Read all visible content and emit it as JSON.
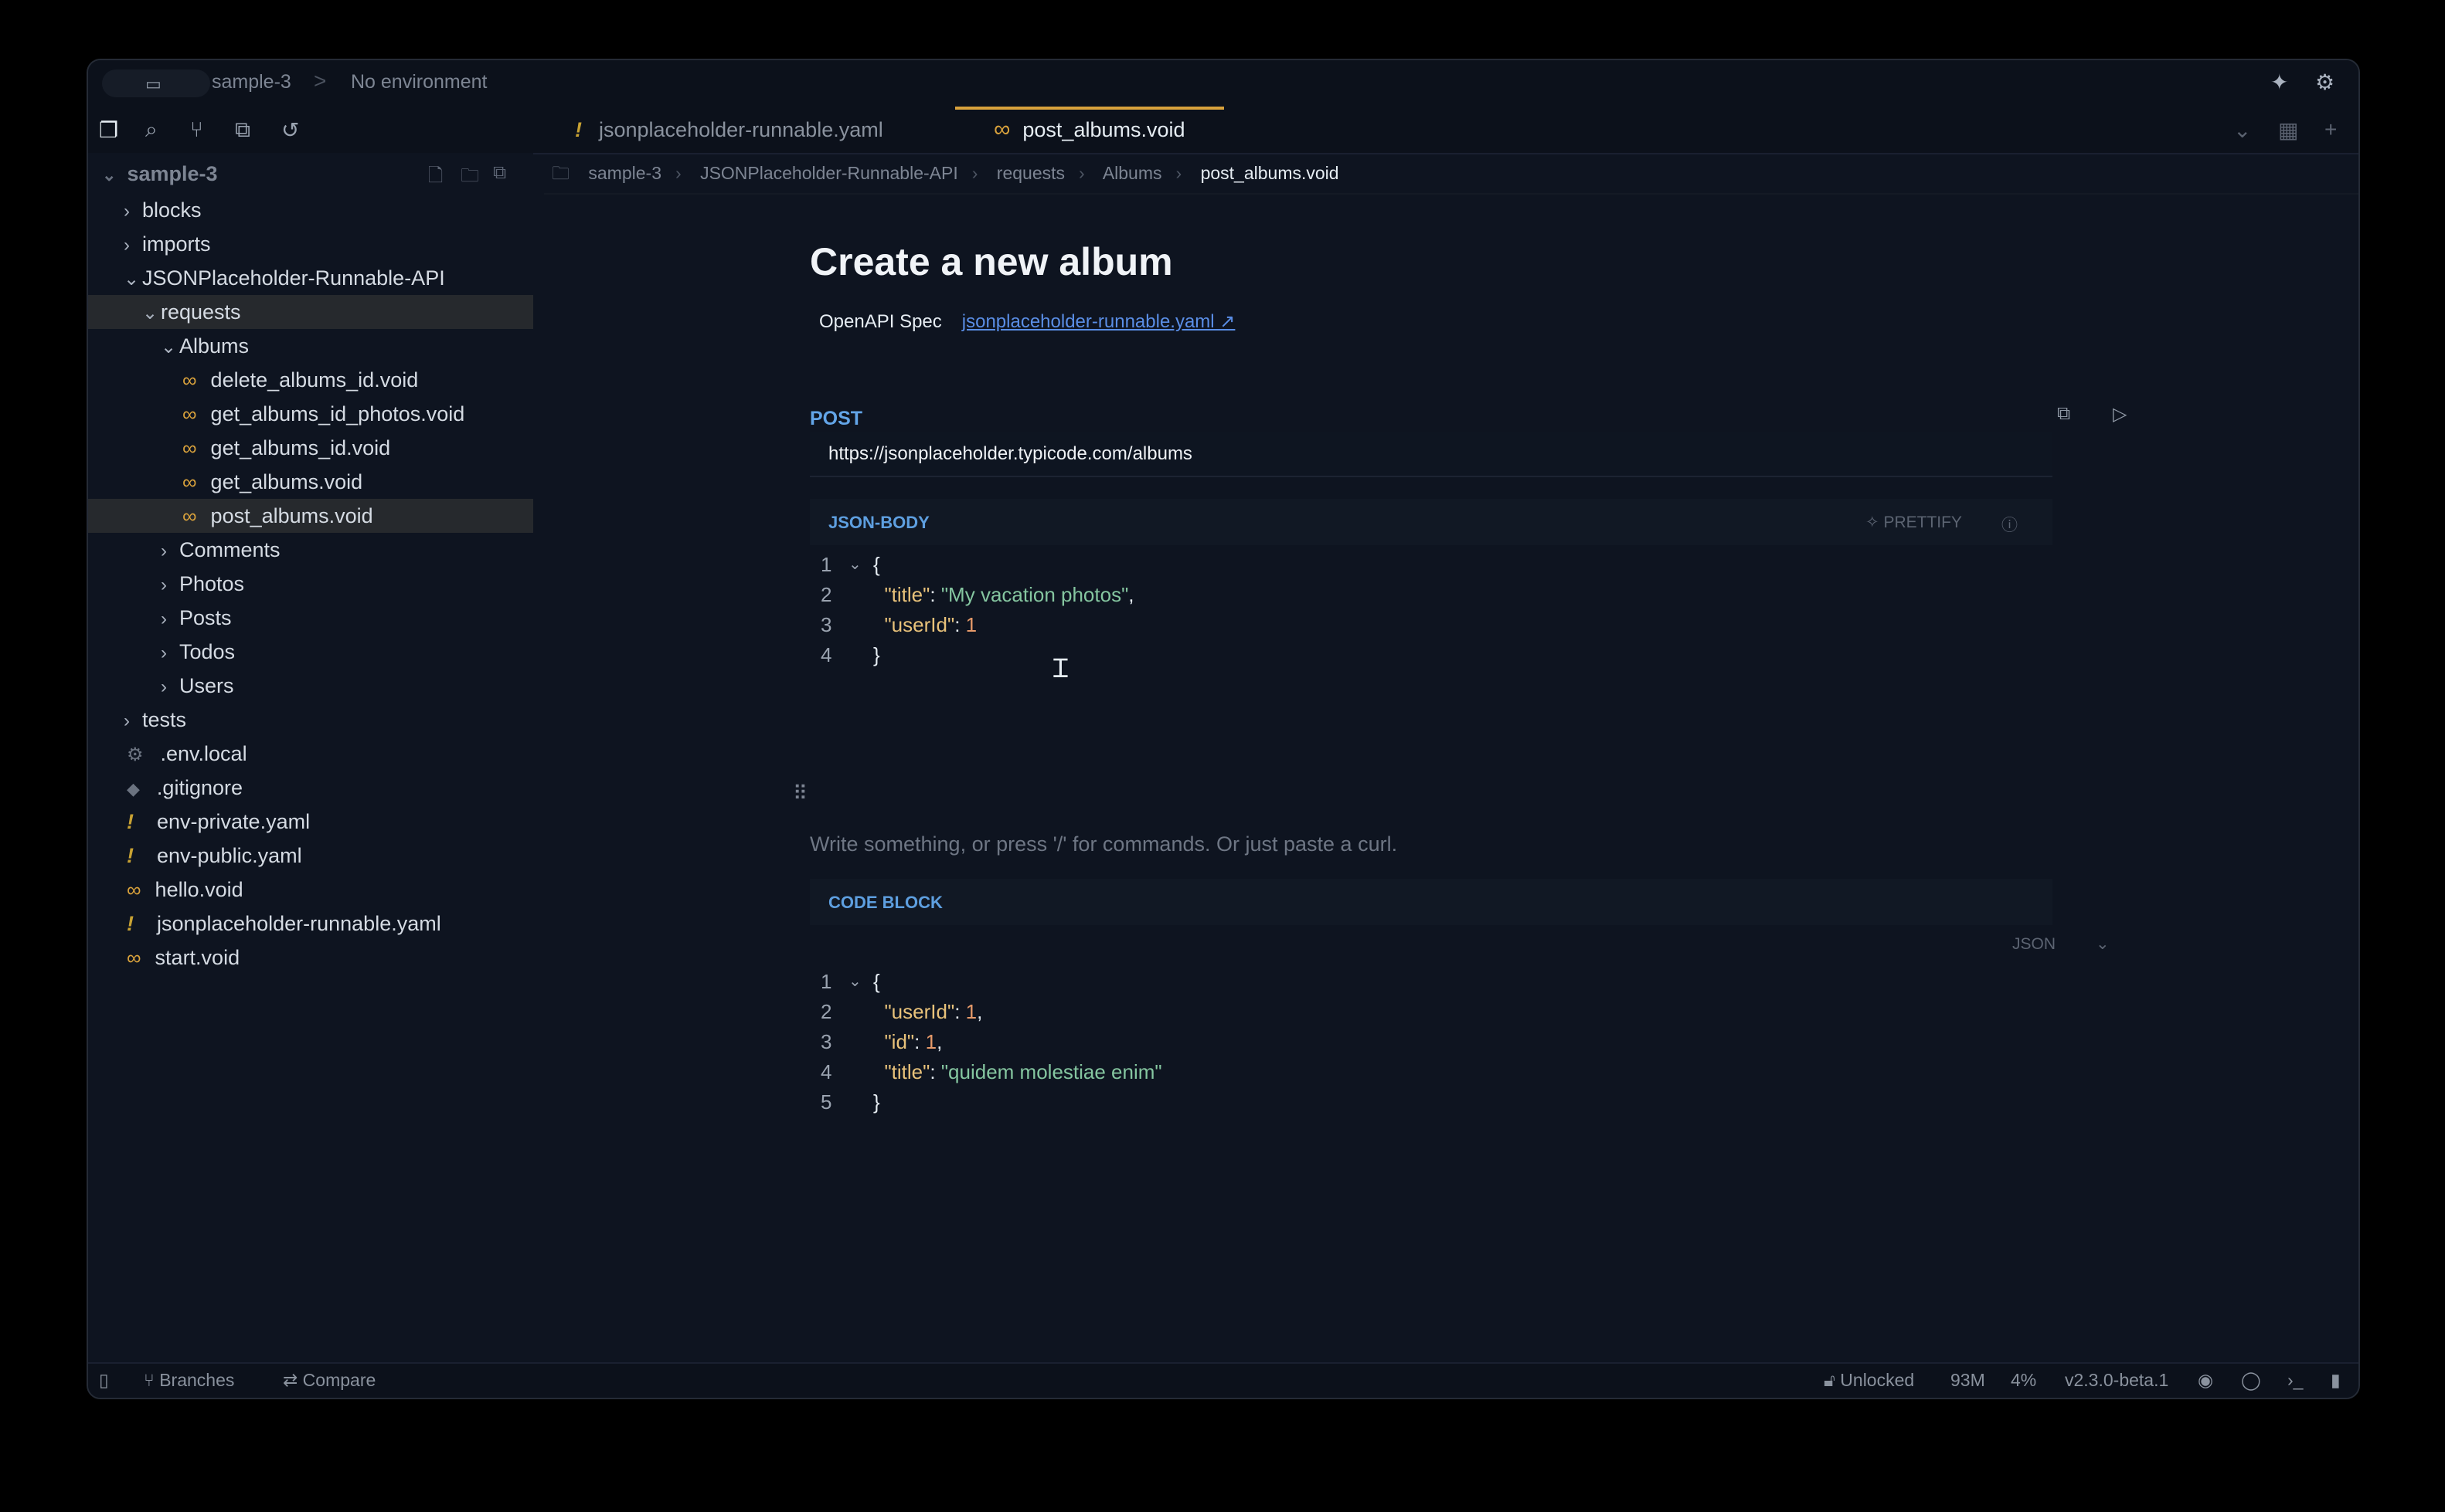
{
  "titlebar": {
    "workspace": "sample-3",
    "separator": ">",
    "environment": "No environment",
    "icons": [
      "monitor-icon",
      "sparkle-icon",
      "gear-icon"
    ]
  },
  "activity": {
    "icons": [
      "files-icon",
      "search-icon",
      "git-branch-icon",
      "extensions-icon",
      "history-icon"
    ]
  },
  "tabs": [
    {
      "label": "jsonplaceholder-runnable.yaml",
      "type": "yaml",
      "active": false
    },
    {
      "label": "post_albums.void",
      "type": "void",
      "active": true
    }
  ],
  "sidebar": {
    "workspace": "sample-3",
    "tree": [
      {
        "label": "blocks",
        "kind": "folder",
        "depth": 0,
        "open": false
      },
      {
        "label": "imports",
        "kind": "folder",
        "depth": 0,
        "open": false
      },
      {
        "label": "JSONPlaceholder-Runnable-API",
        "kind": "folder",
        "depth": 0,
        "open": true
      },
      {
        "label": "requests",
        "kind": "folder",
        "depth": 1,
        "open": true,
        "selected": true
      },
      {
        "label": "Albums",
        "kind": "folder",
        "depth": 2,
        "open": true
      },
      {
        "label": "delete_albums_id.void",
        "kind": "void",
        "depth": 3
      },
      {
        "label": "get_albums_id_photos.void",
        "kind": "void",
        "depth": 3
      },
      {
        "label": "get_albums_id.void",
        "kind": "void",
        "depth": 3
      },
      {
        "label": "get_albums.void",
        "kind": "void",
        "depth": 3
      },
      {
        "label": "post_albums.void",
        "kind": "void",
        "depth": 3,
        "selected": true
      },
      {
        "label": "Comments",
        "kind": "folder",
        "depth": 2,
        "open": false
      },
      {
        "label": "Photos",
        "kind": "folder",
        "depth": 2,
        "open": false
      },
      {
        "label": "Posts",
        "kind": "folder",
        "depth": 2,
        "open": false
      },
      {
        "label": "Todos",
        "kind": "folder",
        "depth": 2,
        "open": false
      },
      {
        "label": "Users",
        "kind": "folder",
        "depth": 2,
        "open": false
      },
      {
        "label": "tests",
        "kind": "folder",
        "depth": 0,
        "open": false
      },
      {
        "label": ".env.local",
        "kind": "env",
        "depth": 0
      },
      {
        "label": ".gitignore",
        "kind": "git",
        "depth": 0
      },
      {
        "label": "env-private.yaml",
        "kind": "yaml",
        "depth": 0
      },
      {
        "label": "env-public.yaml",
        "kind": "yaml",
        "depth": 0
      },
      {
        "label": "hello.void",
        "kind": "void",
        "depth": 0
      },
      {
        "label": "jsonplaceholder-runnable.yaml",
        "kind": "yaml",
        "depth": 0
      },
      {
        "label": "start.void",
        "kind": "void",
        "depth": 0
      }
    ]
  },
  "breadcrumb": [
    "sample-3",
    "JSONPlaceholder-Runnable-API",
    "requests",
    "Albums",
    "post_albums.void"
  ],
  "doc": {
    "title": "Create a new album",
    "spec_label": "OpenAPI Spec",
    "spec_link": "jsonplaceholder-runnable.yaml ↗",
    "method": "POST",
    "url": "https://jsonplaceholder.typicode.com/albums",
    "body_header": "JSON-BODY",
    "prettify": "PRETTIFY",
    "placeholder": "Write something, or press '/' for commands. Or just paste a curl.",
    "code_header": "CODE BLOCK",
    "code_lang": "JSON"
  },
  "body_lines": [
    {
      "n": "1",
      "fold": true,
      "parts": [
        {
          "c": "",
          "t": "{"
        }
      ]
    },
    {
      "n": "2",
      "fold": false,
      "parts": [
        {
          "c": "",
          "t": "  "
        },
        {
          "c": "key",
          "t": "\"title\""
        },
        {
          "c": "",
          "t": ": "
        },
        {
          "c": "str",
          "t": "\"My vacation photos\""
        },
        {
          "c": "",
          "t": ","
        }
      ]
    },
    {
      "n": "3",
      "fold": false,
      "parts": [
        {
          "c": "",
          "t": "  "
        },
        {
          "c": "key",
          "t": "\"userId\""
        },
        {
          "c": "",
          "t": ": "
        },
        {
          "c": "num",
          "t": "1"
        }
      ]
    },
    {
      "n": "4",
      "fold": false,
      "parts": [
        {
          "c": "",
          "t": "}"
        }
      ]
    }
  ],
  "code_lines": [
    {
      "n": "1",
      "fold": true,
      "parts": [
        {
          "c": "",
          "t": "{"
        }
      ]
    },
    {
      "n": "2",
      "fold": false,
      "parts": [
        {
          "c": "",
          "t": "  "
        },
        {
          "c": "key",
          "t": "\"userId\""
        },
        {
          "c": "",
          "t": ": "
        },
        {
          "c": "num",
          "t": "1"
        },
        {
          "c": "",
          "t": ","
        }
      ]
    },
    {
      "n": "3",
      "fold": false,
      "parts": [
        {
          "c": "",
          "t": "  "
        },
        {
          "c": "key",
          "t": "\"id\""
        },
        {
          "c": "",
          "t": ": "
        },
        {
          "c": "num",
          "t": "1"
        },
        {
          "c": "",
          "t": ","
        }
      ]
    },
    {
      "n": "4",
      "fold": false,
      "parts": [
        {
          "c": "",
          "t": "  "
        },
        {
          "c": "key",
          "t": "\"title\""
        },
        {
          "c": "",
          "t": ": "
        },
        {
          "c": "str",
          "t": "\"quidem molestiae enim\""
        }
      ]
    },
    {
      "n": "5",
      "fold": false,
      "parts": [
        {
          "c": "",
          "t": "}"
        }
      ]
    }
  ],
  "statusbar": {
    "branches": "Branches",
    "compare": "Compare",
    "lock": "Unlocked",
    "memory": "93M",
    "cpu": "4%",
    "version": "v2.3.0-beta.1"
  },
  "colors": {
    "accent": "#d9a23c",
    "method": "#63a5e8",
    "background": "#0e1420"
  }
}
